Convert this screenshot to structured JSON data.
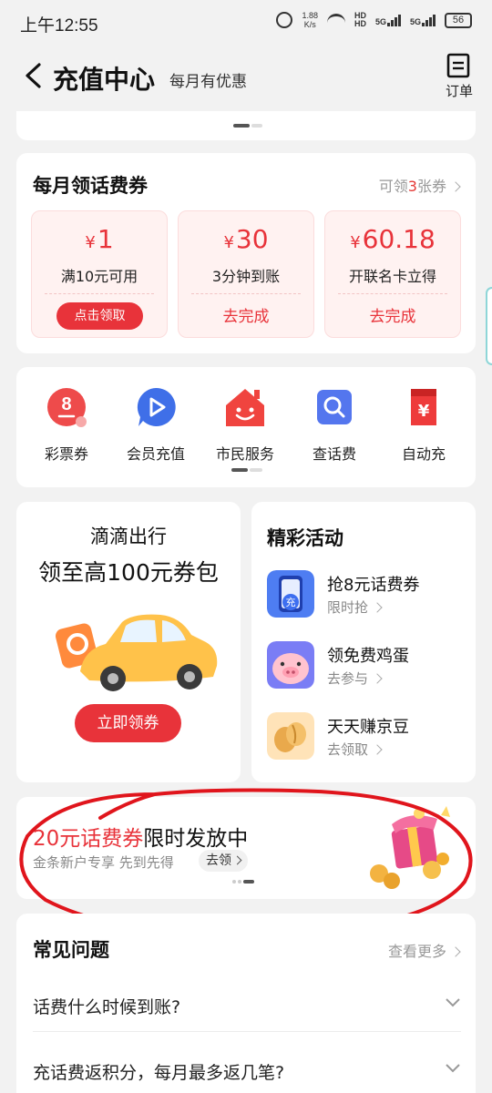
{
  "status_bar": {
    "time": "上午12:55",
    "speed_value": "1.88",
    "speed_unit": "K/s",
    "hd1": "HD",
    "hd2": "HD",
    "net1": "5G",
    "net2": "5G",
    "battery": "56"
  },
  "header": {
    "title": "充值中心",
    "subtitle": "每月有优惠",
    "order_label": "订单"
  },
  "coupon_section": {
    "title": "每月领话费券",
    "more_prefix": "可领",
    "more_count": "3",
    "more_suffix": "张券",
    "coupons": [
      {
        "currency": "¥",
        "amount": "1",
        "desc": "满10元可用",
        "action": "点击领取"
      },
      {
        "currency": "¥",
        "amount": "30",
        "desc": "3分钟到账",
        "action": "去完成"
      },
      {
        "currency": "¥",
        "amount": "60.18",
        "desc": "开联名卡立得",
        "action": "去完成"
      }
    ]
  },
  "services": [
    {
      "label": "彩票券",
      "icon": "lottery-icon"
    },
    {
      "label": "会员充值",
      "icon": "play-icon"
    },
    {
      "label": "市民服务",
      "icon": "citizen-house-icon"
    },
    {
      "label": "查话费",
      "icon": "search-icon"
    },
    {
      "label": "自动充",
      "icon": "yuan-card-icon"
    }
  ],
  "didi": {
    "title1": "滴滴出行",
    "title2": "领至高100元券包",
    "button": "立即领券"
  },
  "activities": {
    "title": "精彩活动",
    "items": [
      {
        "name": "抢8元话费券",
        "sub": "限时抢",
        "thumb_text": "充"
      },
      {
        "name": "领免费鸡蛋",
        "sub": "去参与"
      },
      {
        "name": "天天赚京豆",
        "sub": "去领取"
      }
    ]
  },
  "banner": {
    "title_highlight": "20元话费券",
    "title_rest": "限时发放中",
    "subtitle": "金条新户专享 先到先得",
    "button": "去领"
  },
  "faq": {
    "title": "常见问题",
    "more": "查看更多",
    "questions": [
      "话费什么时候到账?",
      "充话费返积分，每月最多返几笔?"
    ]
  },
  "colors": {
    "accent_red": "#e8333a",
    "annotation_red": "#e0151c"
  }
}
